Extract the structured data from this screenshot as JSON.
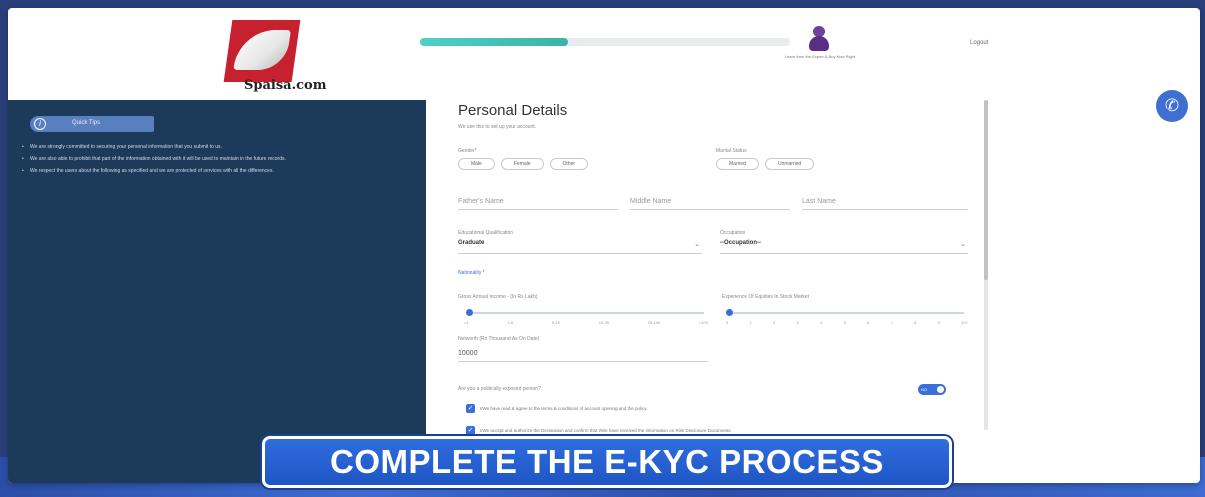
{
  "header": {
    "logo_text": "Spaisa.com",
    "progress_percent": 40,
    "avatar_caption": "Learn from the Expert & Buy Now Right",
    "login_label": "Logout"
  },
  "sidebar": {
    "badge_label": "Quick Tips",
    "tips": [
      "We are strongly committed to securing your personal information that you submit to us.",
      "We are also able to prohibit that part of the information obtained with it will be used to maintain in the future records.",
      "We respect the users about the following as specified and we are protected of services with all the differences."
    ]
  },
  "form": {
    "title": "Personal Details",
    "subtitle": "We use this to set up your account.",
    "gender_label": "Gender*",
    "gender_options": [
      "Male",
      "Female",
      "Other"
    ],
    "marital_label": "Marital Status",
    "marital_options": [
      "Married",
      "Unmarried"
    ],
    "father_name_placeholder": "Father's Name",
    "middle_name_placeholder": "Middle Name",
    "last_name_placeholder": "Last Name",
    "education_label": "Educational Qualification",
    "education_value": "Graduate",
    "occupation_label": "Occupation",
    "occupation_value": "--Occupation--",
    "nationality_link": "Nationality *",
    "income_label": "Gross Annual Income - (In Rs Lakh)",
    "income_ticks": [
      "<1",
      "1-5",
      "5-10",
      "10-25",
      "25-100",
      ">100"
    ],
    "experience_label": "Experience Of Equities In Stock Market",
    "experience_ticks": [
      "0",
      "1",
      "2",
      "3",
      "4",
      "5",
      "6",
      "7",
      "8",
      "9",
      "10+"
    ],
    "networth_label": "Networth (Rs Thousand As On Date)",
    "networth_value": "10000",
    "politically_label": "Are you a politically exposed person?",
    "toggle_label": "NO",
    "check1": "I/We have read & agree to the terms & conditions of account opening and the policy.",
    "check2": "I/We accept and authorize the Declaration and confirm that I/We have received the information on Risk Disclosure Documents."
  },
  "banner": {
    "text": "COMPLETE THE E-KYC PROCESS"
  },
  "colors": {
    "sidebar_bg": "#1c3b5a",
    "accent": "#3a6fd8",
    "progress": "#4fd1c5",
    "brand_red": "#c7202e"
  },
  "icons": {
    "phone": "phone-icon",
    "info": "info-icon",
    "chevron": "chevron-down-icon"
  }
}
